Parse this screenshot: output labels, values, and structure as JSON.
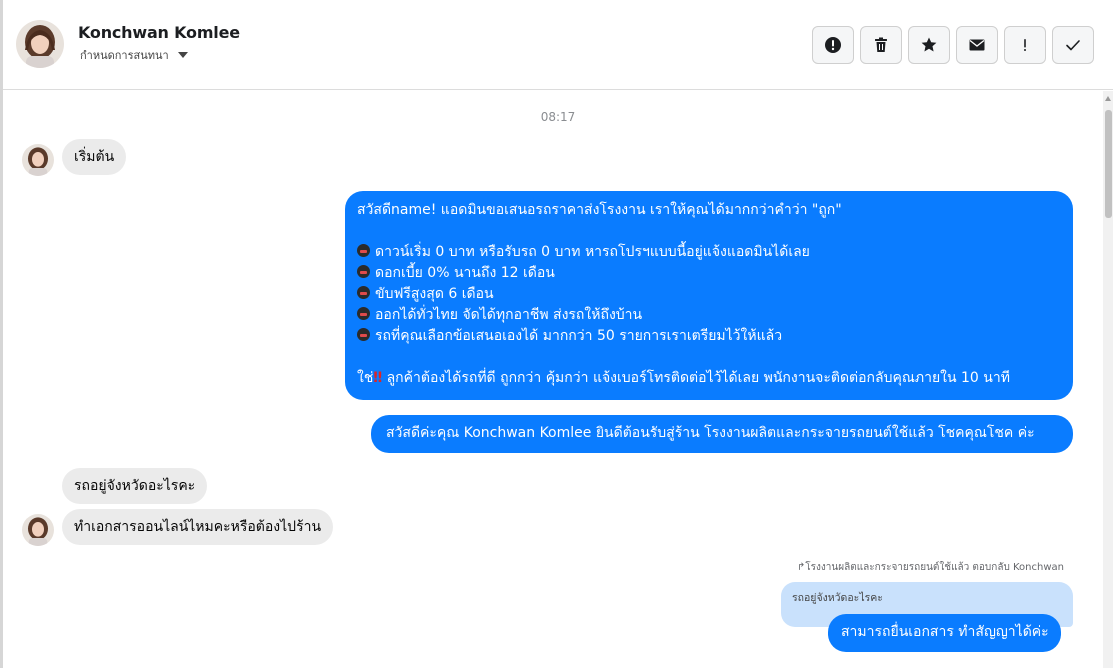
{
  "header": {
    "contact_name": "Konchwan Komlee",
    "assign_label": "กำหนดการสนทนา",
    "actions": [
      {
        "icon": "alert-circle-icon",
        "label": "Mark as spam"
      },
      {
        "icon": "trash-icon",
        "label": "Delete"
      },
      {
        "icon": "star-icon",
        "label": "Star"
      },
      {
        "icon": "envelope-icon",
        "label": "Mark as unread"
      },
      {
        "icon": "exclamation-icon",
        "label": "Follow up"
      },
      {
        "icon": "checkmark-icon",
        "label": "Mark as done"
      }
    ]
  },
  "conversation": {
    "timestamp": "08:17",
    "messages": {
      "m1": {
        "text": "เริ่มต้น"
      },
      "m2": {
        "line1": "สวัสดีname! แอดมินขอเสนอรถราคาส่งโรงงาน เราให้คุณได้มากกว่าคำว่า \"ถูก\"",
        "bullets": [
          "ดาวน์เริ่ม 0 บาท หรือรับรถ 0 บาท หารถโปรฯแบบนี้อยู่แจ้งแอดมินได้เลย",
          "ดอกเบี้ย 0% นานถึง 12 เดือน",
          "ขับฟรีสูงสุด 6 เดือน",
          "ออกได้ทั่วไทย จัดได้ทุกอาชีพ ส่งรถให้ถึงบ้าน",
          "รถที่คุณเลือกข้อเสนอเองได้ มากกว่า 50 รายการเราเตรียมไว้ให้แล้ว"
        ],
        "last_prefix": "ใช่",
        "last_bang": "‼",
        "last_rest": " ลูกค้าต้องได้รถที่ดี ถูกกว่า คุ้มกว่า แจ้งเบอร์โทรติดต่อไว้ได้เลย พนักงานจะติดต่อกลับคุณภายใน 10 นาที"
      },
      "m3": {
        "text": "สวัสดีค่ะคุณ Konchwan Komlee ยินดีต้อนรับสู่ร้าน โรงงานผลิตและกระจายรถยนต์ใช้แล้ว โชคคุณโชค ค่ะ"
      },
      "m4": {
        "text": "รถอยู่จังหวัดอะไรคะ"
      },
      "m5": {
        "text": "ทำเอกสารออนไลน์ไหมคะหรือต้องไปร้าน"
      },
      "reply": {
        "label": "โรงงานผลิตและกระจายรถยนต์ใช้แล้ว ตอบกลับ Konchwan",
        "quoted": "รถอยู่จังหวัดอะไรคะ",
        "text": "สามารถยื่นเอกสาร ทำสัญญาได้ค่ะ"
      }
    }
  },
  "colors": {
    "outgoing": "#0a7cff",
    "incoming": "#ebebeb",
    "quoted": "#c9e1fc"
  }
}
